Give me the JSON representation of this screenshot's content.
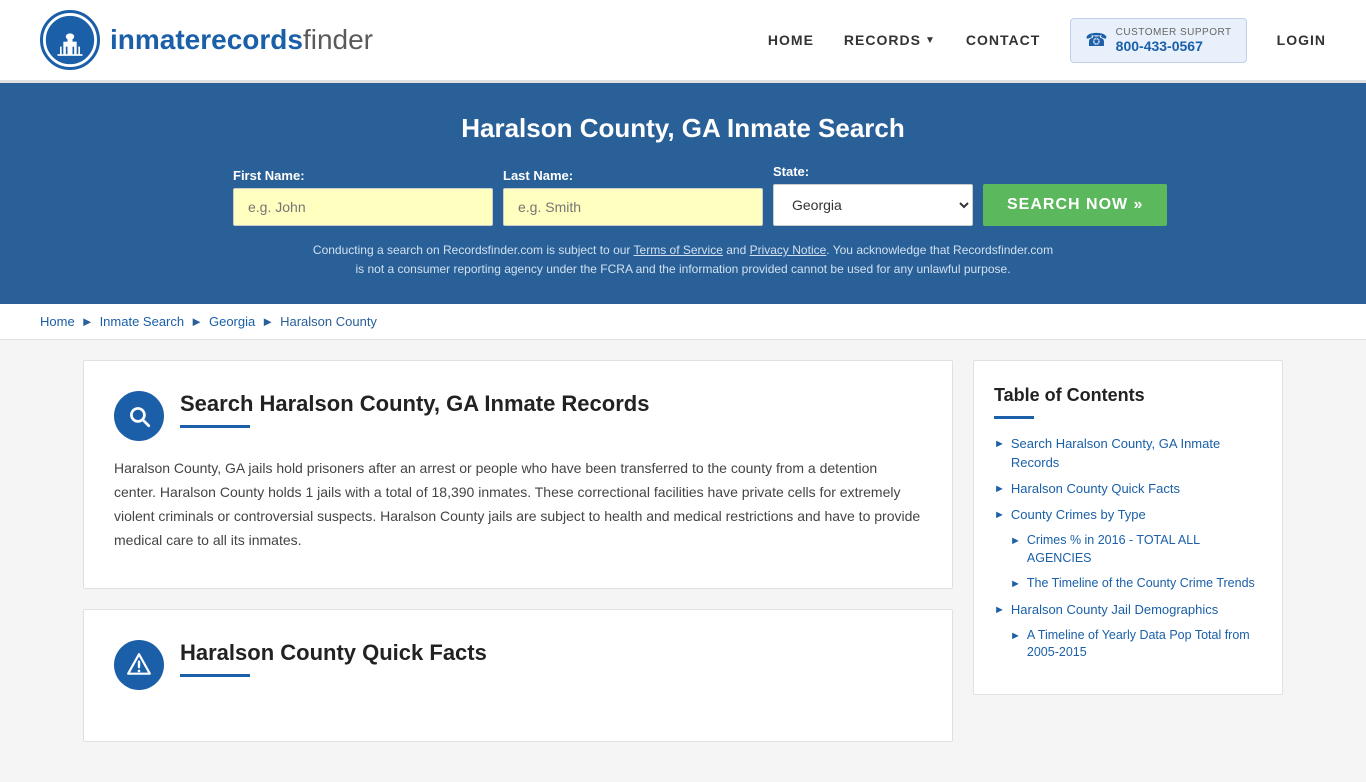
{
  "header": {
    "logo_text_main": "inmaterecords",
    "logo_text_bold": "finder",
    "nav_items": [
      {
        "label": "HOME",
        "id": "nav-home"
      },
      {
        "label": "RECORDS",
        "id": "nav-records",
        "has_dropdown": true
      },
      {
        "label": "CONTACT",
        "id": "nav-contact"
      }
    ],
    "support_label": "CUSTOMER SUPPORT",
    "support_number": "800-433-0567",
    "login_label": "LOGIN"
  },
  "hero": {
    "title": "Haralson County, GA Inmate Search",
    "first_name_label": "First Name:",
    "first_name_placeholder": "e.g. John",
    "last_name_label": "Last Name:",
    "last_name_placeholder": "e.g. Smith",
    "state_label": "State:",
    "state_value": "Georgia",
    "search_btn": "SEARCH NOW »",
    "disclaimer": "Conducting a search on Recordsfinder.com is subject to our Terms of Service and Privacy Notice. You acknowledge that Recordsfinder.com is not a consumer reporting agency under the FCRA and the information provided cannot be used for any unlawful purpose."
  },
  "breadcrumb": {
    "items": [
      {
        "label": "Home",
        "href": "#"
      },
      {
        "label": "Inmate Search",
        "href": "#"
      },
      {
        "label": "Georgia",
        "href": "#"
      },
      {
        "label": "Haralson County",
        "href": "#",
        "current": true
      }
    ]
  },
  "main_card": {
    "icon": "search",
    "title": "Search Haralson County, GA Inmate Records",
    "body": "Haralson County, GA jails hold prisoners after an arrest or people who have been transferred to the county from a detention center. Haralson County holds 1 jails with a total of 18,390 inmates. These correctional facilities have private cells for extremely violent criminals or controversial suspects. Haralson County jails are subject to health and medical restrictions and have to provide medical care to all its inmates."
  },
  "quick_facts_card": {
    "icon": "warning",
    "title": "Haralson County Quick Facts"
  },
  "toc": {
    "title": "Table of Contents",
    "items": [
      {
        "label": "Search Haralson County, GA Inmate Records",
        "href": "#"
      },
      {
        "label": "Haralson County Quick Facts",
        "href": "#"
      },
      {
        "label": "County Crimes by Type",
        "href": "#"
      },
      {
        "label": "Crimes % in 2016 - TOTAL ALL AGENCIES",
        "href": "#",
        "sub": true
      },
      {
        "label": "The Timeline of the County Crime Trends",
        "href": "#",
        "sub": true
      },
      {
        "label": "Haralson County Jail Demographics",
        "href": "#"
      },
      {
        "label": "A Timeline of Yearly Data Pop Total from 2005-2015",
        "href": "#",
        "sub": true
      }
    ]
  }
}
